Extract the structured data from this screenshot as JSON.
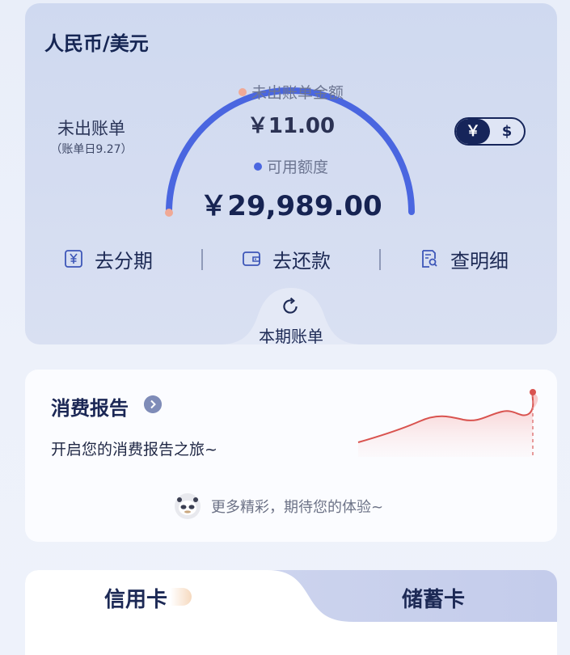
{
  "bill": {
    "currency_title": "人民币/美元",
    "unbilled_label": "未出账单",
    "bill_day": "（账单日9.27）",
    "unbilled_amount_label": "未出账单金额",
    "unbilled_amount": "￥11.00",
    "available_label": "可用额度",
    "available_amount": "￥29,989.00",
    "currency_toggle": {
      "selected": "￥",
      "other": "$"
    },
    "actions": [
      {
        "label": "去分期",
        "icon": "yuan-square-icon"
      },
      {
        "label": "去还款",
        "icon": "wallet-icon"
      },
      {
        "label": "查明细",
        "icon": "search-document-icon"
      }
    ],
    "current_bill_label": "本期账单",
    "colors": {
      "gauge": "#4a66e0",
      "gauge_start": "#f0a996",
      "toggle": "#16255a"
    }
  },
  "report": {
    "title": "消费报告",
    "subtitle": "开启您的消费报告之旅~",
    "footer": "更多精彩，期待您的体验~"
  },
  "card_tabs": {
    "credit_label": "信用卡",
    "debit_label": "储蓄卡",
    "active": "信用卡"
  }
}
